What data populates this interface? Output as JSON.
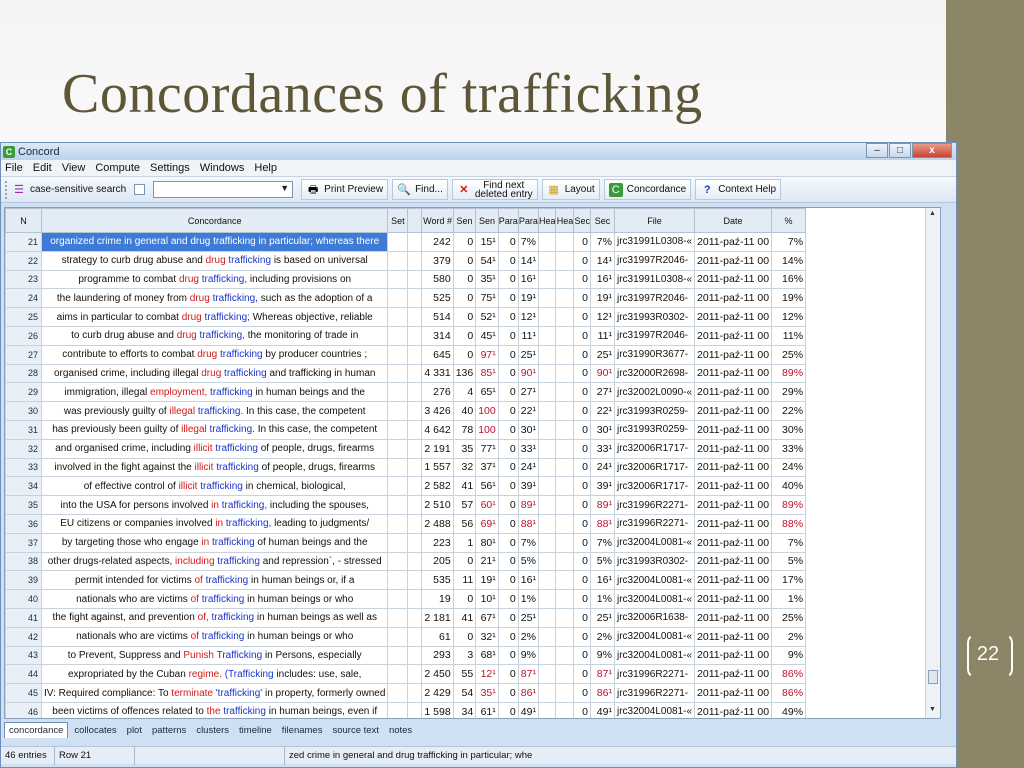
{
  "slide": {
    "title": "Concordances of trafficking",
    "page_number": "22"
  },
  "window": {
    "title": "Concord",
    "controls": [
      "–",
      "□",
      "x"
    ]
  },
  "menu": [
    "File",
    "Edit",
    "View",
    "Compute",
    "Settings",
    "Windows",
    "Help"
  ],
  "toolbar": {
    "case_sensitive": "case-sensitive search",
    "search_value": "",
    "print_preview": "Print Preview",
    "find": "Find...",
    "find_next_line1": "Find next",
    "find_next_line2": "deleted entry",
    "layout": "Layout",
    "concordance": "Concordance",
    "context_help": "Context Help"
  },
  "columns": [
    "N",
    "Concordance",
    "Set",
    "Word #",
    "Sen",
    "Sen",
    "Para",
    "Para",
    "Hea",
    "Hea",
    "Sec",
    "Sec",
    "File",
    "Date",
    "%"
  ],
  "rows": [
    {
      "n": "21",
      "pre": "organized crime in general and",
      "col": "drug",
      "kw": "trafficking",
      "post": "in particular; whereas there",
      "word": "242",
      "s1": "0",
      "s2": "15¹",
      "p1": "0",
      "p2": "7%",
      "sec": "0",
      "sec2": "7%",
      "file": "jrc31991L0308-«",
      "date": "2011-paź-11 00",
      "pct": "7%",
      "red": false,
      "sel": true
    },
    {
      "n": "22",
      "pre": "strategy to curb drug abuse and",
      "col": "drug",
      "kw": "trafficking",
      "post": "is based on universal",
      "word": "379",
      "s1": "0",
      "s2": "54¹",
      "p1": "0",
      "p2": "14¹",
      "sec": "0",
      "sec2": "14¹",
      "file": "jrc31997R2046-",
      "date": "2011-paź-11 00",
      "pct": "14%",
      "red": false
    },
    {
      "n": "23",
      "pre": "programme to combat",
      "col": "drug",
      "kw": "trafficking,",
      "post": "including provisions on",
      "word": "580",
      "s1": "0",
      "s2": "35¹",
      "p1": "0",
      "p2": "16¹",
      "sec": "0",
      "sec2": "16¹",
      "file": "jrc31991L0308-«",
      "date": "2011-paź-11 00",
      "pct": "16%",
      "red": false
    },
    {
      "n": "24",
      "pre": "the laundering of money from",
      "col": "drug",
      "kw": "trafficking,",
      "post": "such as the adoption of a",
      "word": "525",
      "s1": "0",
      "s2": "75¹",
      "p1": "0",
      "p2": "19¹",
      "sec": "0",
      "sec2": "19¹",
      "file": "jrc31997R2046-",
      "date": "2011-paź-11 00",
      "pct": "19%",
      "red": false
    },
    {
      "n": "25",
      "pre": "aims in particular to combat",
      "col": "drug",
      "kw": "trafficking;",
      "post": "Whereas objective, reliable",
      "word": "514",
      "s1": "0",
      "s2": "52¹",
      "p1": "0",
      "p2": "12¹",
      "sec": "0",
      "sec2": "12¹",
      "file": "jrc31993R0302-",
      "date": "2011-paź-11 00",
      "pct": "12%",
      "red": false
    },
    {
      "n": "26",
      "pre": "to curb drug abuse and",
      "col": "drug",
      "kw": "trafficking,",
      "post": "the monitoring of trade in",
      "word": "314",
      "s1": "0",
      "s2": "45¹",
      "p1": "0",
      "p2": "11¹",
      "sec": "0",
      "sec2": "11¹",
      "file": "jrc31997R2046-",
      "date": "2011-paź-11 00",
      "pct": "11%",
      "red": false
    },
    {
      "n": "27",
      "pre": "contribute to efforts to combat",
      "col": "drug",
      "kw": "trafficking",
      "post": "by producer countries ;",
      "word": "645",
      "s1": "0",
      "s2": "97¹",
      "p1": "0",
      "p2": "25¹",
      "sec": "0",
      "sec2": "25¹",
      "file": "jrc31990R3677-",
      "date": "2011-paź-11 00",
      "pct": "25%",
      "red": false,
      "s2red": true
    },
    {
      "n": "28",
      "pre": "organised crime, including illegal",
      "col": "drug",
      "kw": "trafficking",
      "post": "and trafficking in human",
      "word": "4 331",
      "s1": "136",
      "s2": "85¹",
      "p1": "0",
      "p2": "90¹",
      "sec": "0",
      "sec2": "90¹",
      "file": "jrc32000R2698-",
      "date": "2011-paź-11 00",
      "pct": "89%",
      "red": true
    },
    {
      "n": "29",
      "pre": "immigration, illegal",
      "col": "employment,",
      "kw": "trafficking",
      "post": "in human beings and the",
      "word": "276",
      "s1": "4",
      "s2": "65¹",
      "p1": "0",
      "p2": "27¹",
      "sec": "0",
      "sec2": "27¹",
      "file": "jrc32002L0090-«",
      "date": "2011-paź-11 00",
      "pct": "29%",
      "red": false
    },
    {
      "n": "30",
      "pre": "was previously guilty of",
      "col": "illegal",
      "kw": "trafficking.",
      "post": "In this case, the competent",
      "word": "3 426",
      "s1": "40",
      "s2": "100",
      "p1": "0",
      "p2": "22¹",
      "sec": "0",
      "sec2": "22¹",
      "file": "jrc31993R0259-",
      "date": "2011-paź-11 00",
      "pct": "22%",
      "red": false,
      "s2red": true
    },
    {
      "n": "31",
      "pre": "has previously been guilty of",
      "col": "illegal",
      "kw": "trafficking.",
      "post": "In this case, the competent",
      "word": "4 642",
      "s1": "78",
      "s2": "100",
      "p1": "0",
      "p2": "30¹",
      "sec": "0",
      "sec2": "30¹",
      "file": "jrc31993R0259-",
      "date": "2011-paź-11 00",
      "pct": "30%",
      "red": false,
      "s2red": true
    },
    {
      "n": "32",
      "pre": "and organised crime, including",
      "col": "illicit",
      "kw": "trafficking",
      "post": "of people, drugs, firearms",
      "word": "2 191",
      "s1": "35",
      "s2": "77¹",
      "p1": "0",
      "p2": "33¹",
      "sec": "0",
      "sec2": "33¹",
      "file": "jrc32006R1717-",
      "date": "2011-paź-11 00",
      "pct": "33%",
      "red": false
    },
    {
      "n": "33",
      "pre": "involved in the fight against the",
      "col": "illicit",
      "kw": "trafficking",
      "post": "of people, drugs, firearms",
      "word": "1 557",
      "s1": "32",
      "s2": "37¹",
      "p1": "0",
      "p2": "24¹",
      "sec": "0",
      "sec2": "24¹",
      "file": "jrc32006R1717-",
      "date": "2011-paź-11 00",
      "pct": "24%",
      "red": false
    },
    {
      "n": "34",
      "pre": "of effective control of",
      "col": "illicit",
      "kw": "trafficking",
      "post": "in chemical, biological,",
      "word": "2 582",
      "s1": "41",
      "s2": "56¹",
      "p1": "0",
      "p2": "39¹",
      "sec": "0",
      "sec2": "39¹",
      "file": "jrc32006R1717-",
      "date": "2011-paź-11 00",
      "pct": "40%",
      "red": false
    },
    {
      "n": "35",
      "pre": "into the USA for persons involved",
      "col": "in",
      "kw": "trafficking,",
      "post": "including the spouses,",
      "word": "2 510",
      "s1": "57",
      "s2": "60¹",
      "p1": "0",
      "p2": "89¹",
      "sec": "0",
      "sec2": "89¹",
      "file": "jrc31996R2271-",
      "date": "2011-paź-11 00",
      "pct": "89%",
      "red": true
    },
    {
      "n": "36",
      "pre": "EU citizens or companies involved",
      "col": "in",
      "kw": "trafficking,",
      "post": "leading to judgments/",
      "word": "2 488",
      "s1": "56",
      "s2": "69¹",
      "p1": "0",
      "p2": "88¹",
      "sec": "0",
      "sec2": "88¹",
      "file": "jrc31996R2271-",
      "date": "2011-paź-11 00",
      "pct": "88%",
      "red": true
    },
    {
      "n": "37",
      "pre": "by targeting those who engage",
      "col": "in",
      "kw": "trafficking",
      "post": "of human beings and the",
      "word": "223",
      "s1": "1",
      "s2": "80¹",
      "p1": "0",
      "p2": "7%",
      "sec": "0",
      "sec2": "7%",
      "file": "jrc32004L0081-«",
      "date": "2011-paź-11 00",
      "pct": "7%",
      "red": false
    },
    {
      "n": "38",
      "pre": "other drugs-related aspects,",
      "col": "including",
      "kw": "trafficking",
      "post": "and repression`, - stressed",
      "word": "205",
      "s1": "0",
      "s2": "21¹",
      "p1": "0",
      "p2": "5%",
      "sec": "0",
      "sec2": "5%",
      "file": "jrc31993R0302-",
      "date": "2011-paź-11 00",
      "pct": "5%",
      "red": false
    },
    {
      "n": "39",
      "pre": "permit intended for victims",
      "col": "of",
      "kw": "trafficking",
      "post": "in human beings or, if a",
      "word": "535",
      "s1": "11",
      "s2": "19¹",
      "p1": "0",
      "p2": "16¹",
      "sec": "0",
      "sec2": "16¹",
      "file": "jrc32004L0081-«",
      "date": "2011-paź-11 00",
      "pct": "17%",
      "red": false
    },
    {
      "n": "40",
      "pre": "nationals who are victims",
      "col": "of",
      "kw": "trafficking",
      "post": "in human beings or who",
      "word": "19",
      "s1": "0",
      "s2": "10¹",
      "p1": "0",
      "p2": "1%",
      "sec": "0",
      "sec2": "1%",
      "file": "jrc32004L0081-«",
      "date": "2011-paź-11 00",
      "pct": "1%",
      "red": false
    },
    {
      "n": "41",
      "pre": "the fight against, and prevention",
      "col": "of,",
      "kw": "trafficking",
      "post": "in human beings as well as",
      "word": "2 181",
      "s1": "41",
      "s2": "67¹",
      "p1": "0",
      "p2": "25¹",
      "sec": "0",
      "sec2": "25¹",
      "file": "jrc32006R1638-",
      "date": "2011-paź-11 00",
      "pct": "25%",
      "red": false
    },
    {
      "n": "42",
      "pre": "nationals who are victims",
      "col": "of",
      "kw": "trafficking",
      "post": "in human beings or who",
      "word": "61",
      "s1": "0",
      "s2": "32¹",
      "p1": "0",
      "p2": "2%",
      "sec": "0",
      "sec2": "2%",
      "file": "jrc32004L0081-«",
      "date": "2011-paź-11 00",
      "pct": "2%",
      "red": false
    },
    {
      "n": "43",
      "pre": "to Prevent, Suppress and",
      "col": "Punish",
      "kw": "Trafficking",
      "post": "in Persons, especially",
      "word": "293",
      "s1": "3",
      "s2": "68¹",
      "p1": "0",
      "p2": "9%",
      "sec": "0",
      "sec2": "9%",
      "file": "jrc32004L0081-«",
      "date": "2011-paź-11 00",
      "pct": "9%",
      "red": false
    },
    {
      "n": "44",
      "pre": "expropriated by the Cuban",
      "col": "regime.",
      "kw": "(Trafficking",
      "post": "includes: use, sale,",
      "word": "2 450",
      "s1": "55",
      "s2": "12¹",
      "p1": "0",
      "p2": "87¹",
      "sec": "0",
      "sec2": "87¹",
      "file": "jrc31996R2271-",
      "date": "2011-paź-11 00",
      "pct": "86%",
      "red": true
    },
    {
      "n": "45",
      "pre": "IV: Required compliance: To",
      "col": "terminate",
      "kw": "'trafficking'",
      "post": "in property, formerly owned",
      "word": "2 429",
      "s1": "54",
      "s2": "35¹",
      "p1": "0",
      "p2": "86¹",
      "sec": "0",
      "sec2": "86¹",
      "file": "jrc31996R2271-",
      "date": "2011-paź-11 00",
      "pct": "86%",
      "red": true
    },
    {
      "n": "46",
      "pre": "been victims of offences related to",
      "col": "the",
      "kw": "trafficking",
      "post": "in human beings, even if",
      "word": "1 598",
      "s1": "34",
      "s2": "61¹",
      "p1": "0",
      "p2": "49¹",
      "sec": "0",
      "sec2": "49¹",
      "file": "jrc32004L0081-«",
      "date": "2011-paź-11 00",
      "pct": "49%",
      "red": false
    }
  ],
  "tabs": [
    "concordance",
    "collocates",
    "plot",
    "patterns",
    "clusters",
    "timeline",
    "filenames",
    "source text",
    "notes"
  ],
  "status": {
    "entries": "46 entries",
    "row": "Row 21",
    "blank": "",
    "context": "zed crime in general and drug trafficking in particular; whe"
  }
}
